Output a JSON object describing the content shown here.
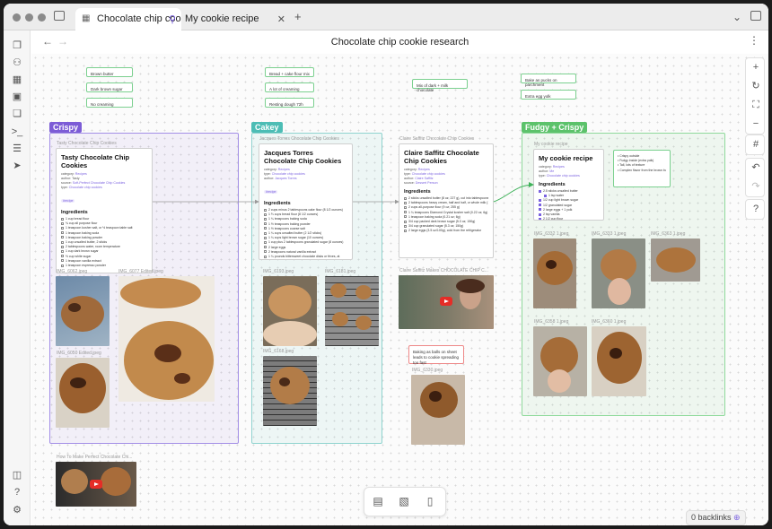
{
  "app": {
    "tabs": [
      {
        "label": "Chocolate chip cooki...",
        "active": true
      },
      {
        "label": "My cookie recipe",
        "active": false
      }
    ],
    "page_title": "Chocolate chip cookie research",
    "backlinks": "0 backlinks"
  },
  "notes": {
    "top_left": [
      "Brown butter",
      "Dark brown sugar",
      "No creaming"
    ],
    "top_mid": [
      "Bread + cake flour mix",
      "A lot of creaming",
      "Resting dough 72h"
    ],
    "mid": "Mix of dark + milk chocolate",
    "top_right": [
      "Bake as pucks on parchment",
      "Extra egg yolk"
    ],
    "spread": "Baking as balls on sheet leads to cookie spreading too fast"
  },
  "groups": {
    "crispy": "Crispy",
    "cakey": "Cakey",
    "fudgy": "Fudgy + Crispy",
    "crispy_color": "#7c5cd6",
    "cakey_color": "#4dbdb5",
    "fudgy_color": "#5cc26b"
  },
  "cards": {
    "tasty": {
      "file": "Tasty Chocolate Chip Cookies",
      "title": "Tasty Chocolate Chip Cookies",
      "category_label": "category:",
      "category": "Recipes",
      "author_label": "author:",
      "author": "Tasty",
      "source_label": "source:",
      "source": "Soft-Perfect Chocolate Chip Cookies",
      "type_label": "type:",
      "type": "Chocolate chip cookies",
      "tag": "#recipe",
      "ingredients_heading": "Ingredients",
      "ingredients": [
        "1 cup bread flour",
        "¾ cup all purpose flour",
        "1 teaspoon kosher salt, or ½ teaspoon table salt",
        "1 teaspoon baking soda",
        "1 teaspoon baking powder",
        "1 cup unsalted butter, 2 sticks",
        "2 tablespoons water, room temperature",
        "1 cup dark brown sugar",
        "½ cup white sugar",
        "1 teaspoon vanilla extract",
        "1 teaspoon espresso powder"
      ]
    },
    "jacques": {
      "file": "Jacques Torres Chocolate Chip Cookies",
      "title": "Jacques Torres Chocolate Chip Cookies",
      "category_label": "category:",
      "category": "Recipes",
      "type_label": "type:",
      "type": "Chocolate chip cookies",
      "author_label": "author:",
      "author": "Jacques Torres",
      "tag": "#recipe",
      "ingredients_heading": "Ingredients",
      "ingredients": [
        "2 cups minus 2 tablespoons cake flour (8 1/2 ounces)",
        "1 ⅔ cups bread flour (8 1/2 ounces)",
        "1 ¼ teaspoons baking soda",
        "1 ½ teaspoons baking powder",
        "1 ½ teaspoons coarse salt",
        "1 ¼ cups unsalted butter (2 1/2 sticks)",
        "1 ¼ cups light brown sugar (10 ounces)",
        "1 cup plus 2 tablespoons granulated sugar (8 ounces)",
        "2 large eggs",
        "2 teaspoons natural vanilla extract",
        "1 ¼ pounds bittersweet chocolate disks or fèves, at"
      ]
    },
    "claire": {
      "file": "Claire Saffitz Chocolate Chip Cookies",
      "title": "Claire Saffitz Chocolate Chip Cookies",
      "category_label": "category:",
      "category": "Recipes",
      "type_label": "type:",
      "type": "Chocolate chip cookies",
      "author_label": "author:",
      "author": "Claire Saffitz",
      "source_label": "source:",
      "source": "Dessert Person",
      "ingredients_heading": "Ingredients",
      "ingredients": [
        "2 sticks unsalted butter (8 oz; 227 g), cut into tablespoons",
        "2 tablespoons heavy cream, half and half, or whole milk (1 oz; 28 g)",
        "2 cups all-purpose flour (9 oz; 255 g)",
        "1 ¼ teaspoons Diamond Crystal kosher salt (0.22 oz; 6g)",
        "1 teaspoon baking soda (0.21 oz; 6g)",
        "3/4 cup packed dark brown sugar (5.3 oz; 150g)",
        "3/4 cup granulated sugar (5.3 oz; 150g)",
        "2 large eggs (3.5 oz/100g), cold from the refrigerator"
      ]
    },
    "mine": {
      "file": "My cookie recipe",
      "title": "My cookie recipe",
      "category_label": "category:",
      "category": "Recipes",
      "author_label": "author:",
      "author": "Me",
      "type_label": "type:",
      "type": "Chocolate chip cookies",
      "ingredients_heading": "Ingredients",
      "ingredients": [
        "2.5 sticks unsalted butter",
        "1 tsp water",
        "1/2 cup light brown sugar",
        "1/2 granulated sugar",
        "2 large eggs + 1 yolk",
        "2 tsp vanilla",
        "2 1/2 cup flour"
      ],
      "notes": [
        "Crispy outside",
        "Fudgy inside (extra yolk)",
        "Tall, lots of texture",
        "Complex flavor from the brown butter and the combination of chocolate"
      ]
    }
  },
  "images": {
    "img6062": "IMG_6062.jpeg",
    "img6077": "IMG_6077 Edited.jpeg",
    "img6050": "IMG_6050 Edited.jpeg",
    "img6193": "IMG_6193.jpeg",
    "img6181": "IMG_6181.jpeg",
    "img6168": "IMG_6168.jpeg",
    "img6330": "IMG_6330.jpeg",
    "img6332": "IMG_6332 1.jpeg",
    "img6333": "IMG_6333 1.jpeg",
    "img6363": "IMG_6363 1.jpeg",
    "img6358": "IMG_6358 1.jpeg",
    "img6360": "IMG_6360 1.jpeg",
    "video_claire": "Claire Saffitz Makes CHOCOLATE CHIP C...",
    "video_perfect": "How To Make Perfect Chocolate Chi..."
  },
  "icons": {
    "ribbon": [
      "files-icon",
      "graph-icon",
      "canvas-icon",
      "calendar-icon",
      "copy-icon",
      "terminal-icon",
      "template-icon",
      "send-icon"
    ],
    "ribbon_bottom": [
      "vault-icon",
      "help-icon",
      "settings-icon"
    ],
    "controls": [
      "zoom-in-icon",
      "reset-zoom-icon",
      "fit-icon",
      "zoom-out-icon",
      "snap-icon",
      "undo-icon",
      "redo-icon",
      "help-icon"
    ],
    "bottombar": [
      "add-note-icon",
      "add-media-icon",
      "add-file-icon"
    ]
  }
}
